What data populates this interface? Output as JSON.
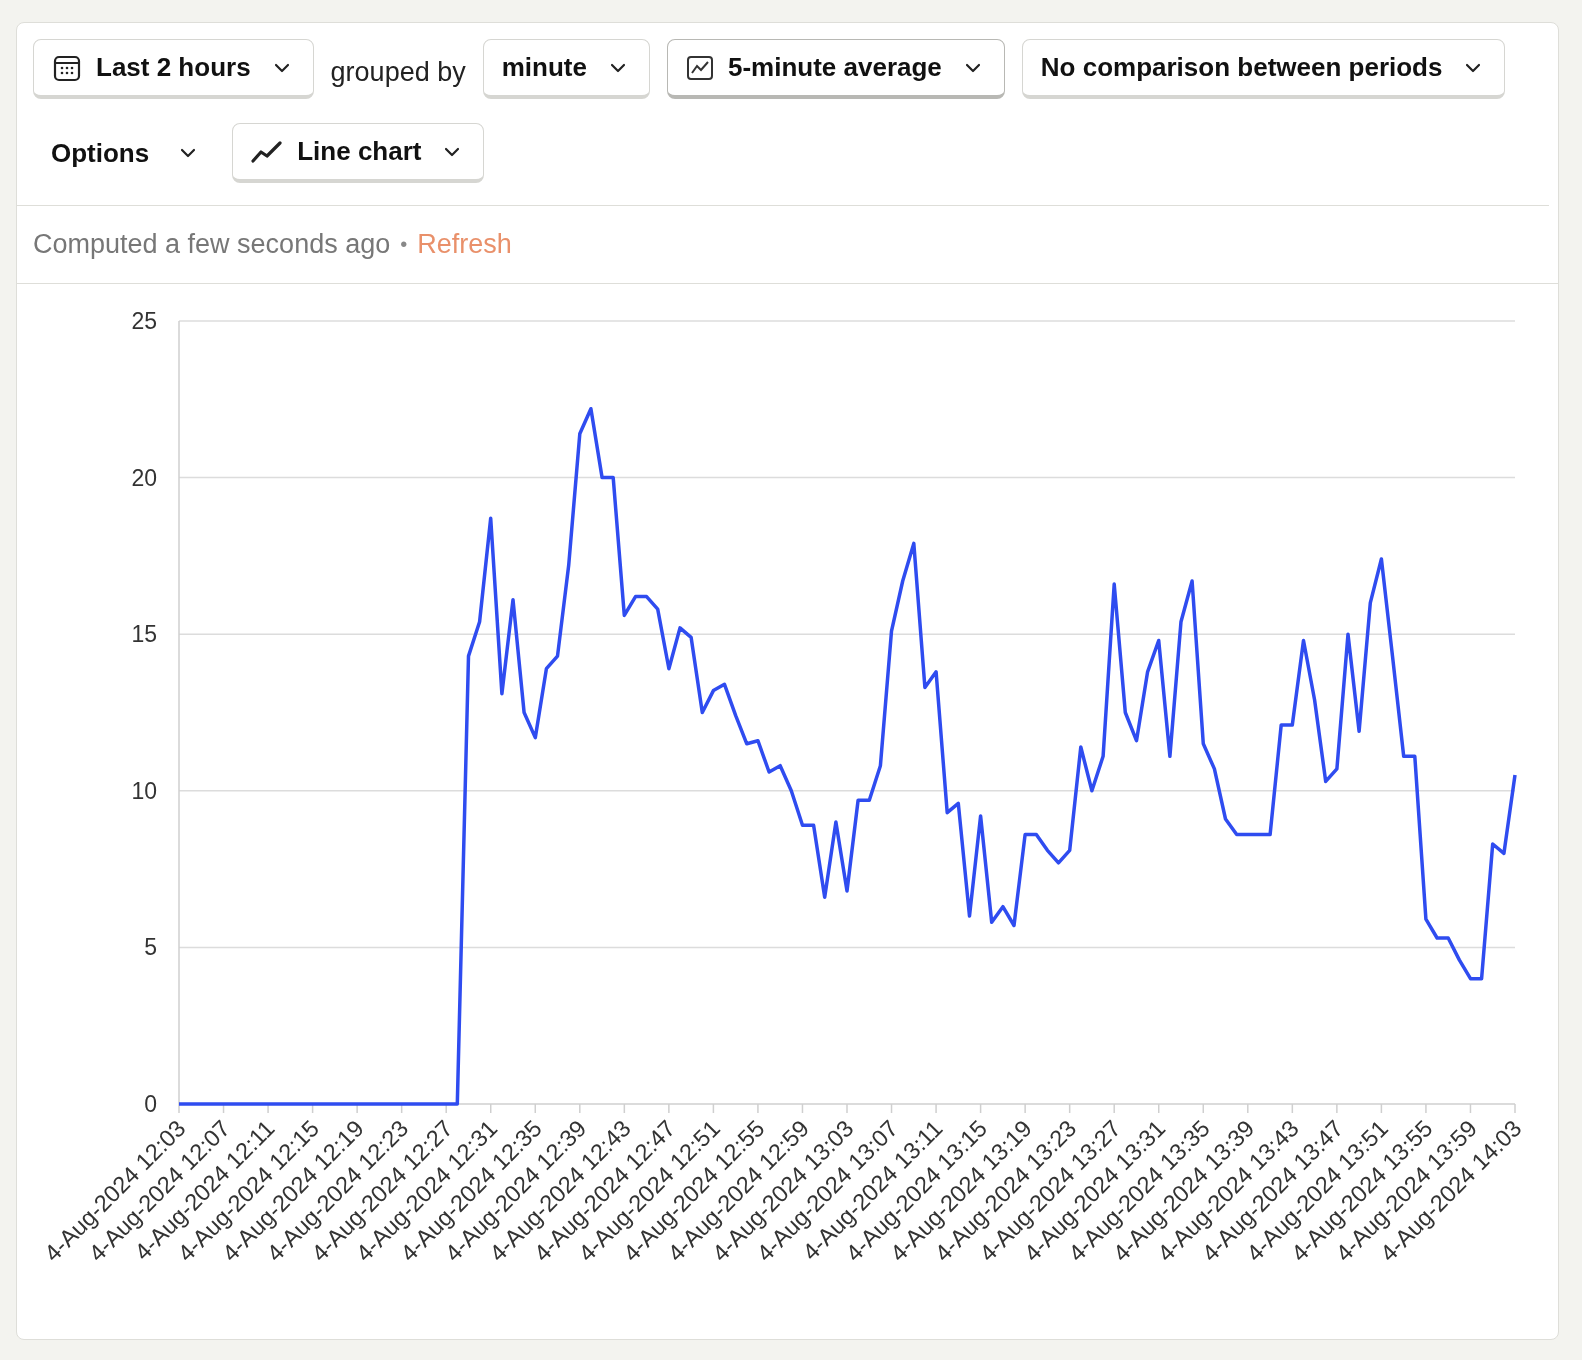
{
  "toolbar": [
    {
      "kind": "select",
      "label": "Last 2 hours"
    },
    {
      "kind": "text",
      "label": "grouped by"
    },
    {
      "kind": "select",
      "label": "minute"
    },
    {
      "kind": "select",
      "label": "5-minute average"
    },
    {
      "kind": "select",
      "label": "No comparison between periods"
    },
    {
      "kind": "menu",
      "label": "Options"
    },
    {
      "kind": "select",
      "label": "Line chart"
    }
  ],
  "status": {
    "text": "Computed a few seconds ago",
    "separator": "•",
    "refresh": "Refresh"
  },
  "chart": {
    "chart_data": {
      "type": "line",
      "grid": true,
      "ylim": [
        0,
        25
      ],
      "yticks": [
        0,
        5,
        10,
        15,
        20,
        25
      ],
      "categories": [
        "4-Aug-2024 12:03",
        null,
        null,
        null,
        "4-Aug-2024 12:07",
        null,
        null,
        null,
        "4-Aug-2024 12:11",
        null,
        null,
        null,
        "4-Aug-2024 12:15",
        null,
        null,
        null,
        "4-Aug-2024 12:19",
        null,
        null,
        null,
        "4-Aug-2024 12:23",
        null,
        null,
        null,
        "4-Aug-2024 12:27",
        null,
        null,
        null,
        "4-Aug-2024 12:31",
        null,
        null,
        null,
        "4-Aug-2024 12:35",
        null,
        null,
        null,
        "4-Aug-2024 12:39",
        null,
        null,
        null,
        "4-Aug-2024 12:43",
        null,
        null,
        null,
        "4-Aug-2024 12:47",
        null,
        null,
        null,
        "4-Aug-2024 12:51",
        null,
        null,
        null,
        "4-Aug-2024 12:55",
        null,
        null,
        null,
        "4-Aug-2024 12:59",
        null,
        null,
        null,
        "4-Aug-2024 13:03",
        null,
        null,
        null,
        "4-Aug-2024 13:07",
        null,
        null,
        null,
        "4-Aug-2024 13:11",
        null,
        null,
        null,
        "4-Aug-2024 13:15",
        null,
        null,
        null,
        "4-Aug-2024 13:19",
        null,
        null,
        null,
        "4-Aug-2024 13:23",
        null,
        null,
        null,
        "4-Aug-2024 13:27",
        null,
        null,
        null,
        "4-Aug-2024 13:31",
        null,
        null,
        null,
        "4-Aug-2024 13:35",
        null,
        null,
        null,
        "4-Aug-2024 13:39",
        null,
        null,
        null,
        "4-Aug-2024 13:43",
        null,
        null,
        null,
        "4-Aug-2024 13:47",
        null,
        null,
        null,
        "4-Aug-2024 13:51",
        null,
        null,
        null,
        "4-Aug-2024 13:55",
        null,
        null,
        null,
        "4-Aug-2024 13:59",
        null,
        null,
        null,
        "4-Aug-2024 14:03"
      ],
      "series": [
        {
          "color": "#2f4cf0",
          "values": [
            0,
            0,
            0,
            0,
            0,
            0,
            0,
            0,
            0,
            0,
            0,
            0,
            0,
            0,
            0,
            0,
            0,
            0,
            0,
            0,
            0,
            0,
            0,
            0,
            0,
            0,
            14.3,
            15.4,
            18.7,
            13.1,
            16.1,
            12.5,
            11.7,
            13.9,
            14.3,
            17.2,
            21.4,
            22.2,
            20.0,
            20.0,
            15.6,
            16.2,
            16.2,
            15.8,
            13.9,
            15.2,
            14.9,
            12.5,
            13.2,
            13.4,
            12.4,
            11.5,
            11.6,
            10.6,
            10.8,
            10.0,
            8.9,
            8.9,
            6.6,
            9.0,
            6.8,
            9.7,
            9.7,
            10.8,
            15.1,
            16.7,
            17.9,
            13.3,
            13.8,
            9.3,
            9.6,
            6.0,
            9.2,
            5.8,
            6.3,
            5.7,
            8.6,
            8.6,
            8.1,
            7.7,
            8.1,
            11.4,
            10.0,
            11.1,
            16.6,
            12.5,
            11.6,
            13.8,
            14.8,
            11.1,
            15.4,
            16.7,
            11.5,
            10.7,
            9.1,
            8.6,
            8.6,
            8.6,
            8.6,
            12.1,
            12.1,
            14.8,
            12.9,
            10.3,
            10.7,
            15.0,
            11.9,
            16.0,
            17.4,
            14.3,
            11.1,
            11.1,
            5.9,
            5.3,
            5.3,
            4.6,
            4.0,
            4.0,
            8.3,
            8.0,
            10.5
          ]
        }
      ]
    }
  }
}
